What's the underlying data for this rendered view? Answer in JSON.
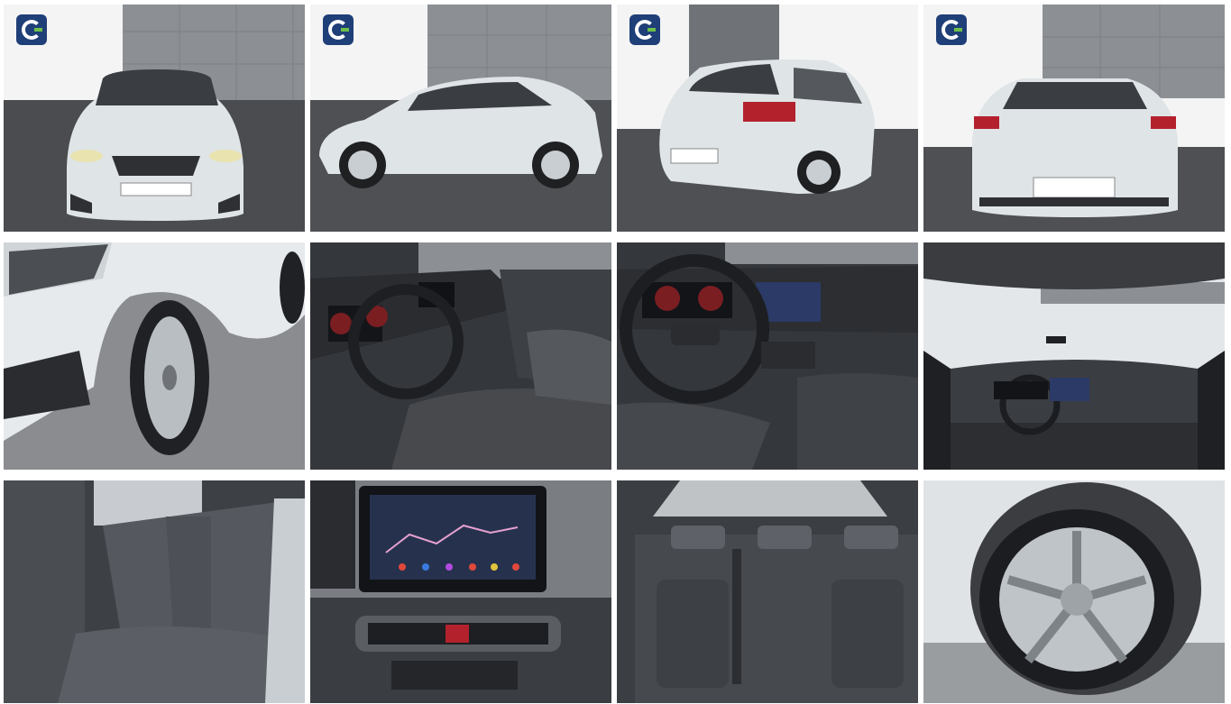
{
  "gallery": {
    "photos": [
      {
        "id": 1,
        "view": "front",
        "logo": true
      },
      {
        "id": 2,
        "view": "side",
        "logo": true
      },
      {
        "id": 3,
        "view": "rear-three-quarter",
        "logo": true
      },
      {
        "id": 4,
        "view": "rear",
        "logo": true
      },
      {
        "id": 5,
        "view": "front-wheel-detail",
        "logo": false
      },
      {
        "id": 6,
        "view": "dashboard-driver-door",
        "logo": false
      },
      {
        "id": 7,
        "view": "steering-wheel-dashboard",
        "logo": false
      },
      {
        "id": 8,
        "view": "interior-panorama-roof",
        "logo": false
      },
      {
        "id": 9,
        "view": "rear-seats-side",
        "logo": false
      },
      {
        "id": 10,
        "view": "infotainment-screen",
        "logo": false
      },
      {
        "id": 11,
        "view": "rear-bench",
        "logo": false
      },
      {
        "id": 12,
        "view": "alloy-wheel",
        "logo": false
      }
    ]
  },
  "colors": {
    "car_body": "#dfe4e7",
    "wall_panel": "#8c9094",
    "asphalt": "#4a4c4f",
    "interior_dark": "#3a3d41",
    "logo_blue": "#1f3f78",
    "logo_green": "#6cc04a"
  },
  "icons": {
    "dealer_logo": "dealer-logo-icon"
  }
}
